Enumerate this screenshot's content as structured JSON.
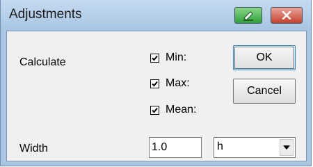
{
  "window": {
    "title": "Adjustments"
  },
  "titlebar": {
    "pin_icon": "pen-icon",
    "close_icon": "close-icon"
  },
  "calculate": {
    "label": "Calculate",
    "options": [
      {
        "label": "Min:",
        "checked": true
      },
      {
        "label": "Max:",
        "checked": true
      },
      {
        "label": "Mean:",
        "checked": true
      }
    ]
  },
  "buttons": {
    "ok": "OK",
    "cancel": "Cancel"
  },
  "width": {
    "label": "Width",
    "value": "1.0",
    "unit_selected": "h"
  },
  "colors": {
    "accent": "#3c7fb1",
    "close": "#c8402e",
    "pin": "#2ea23a"
  }
}
